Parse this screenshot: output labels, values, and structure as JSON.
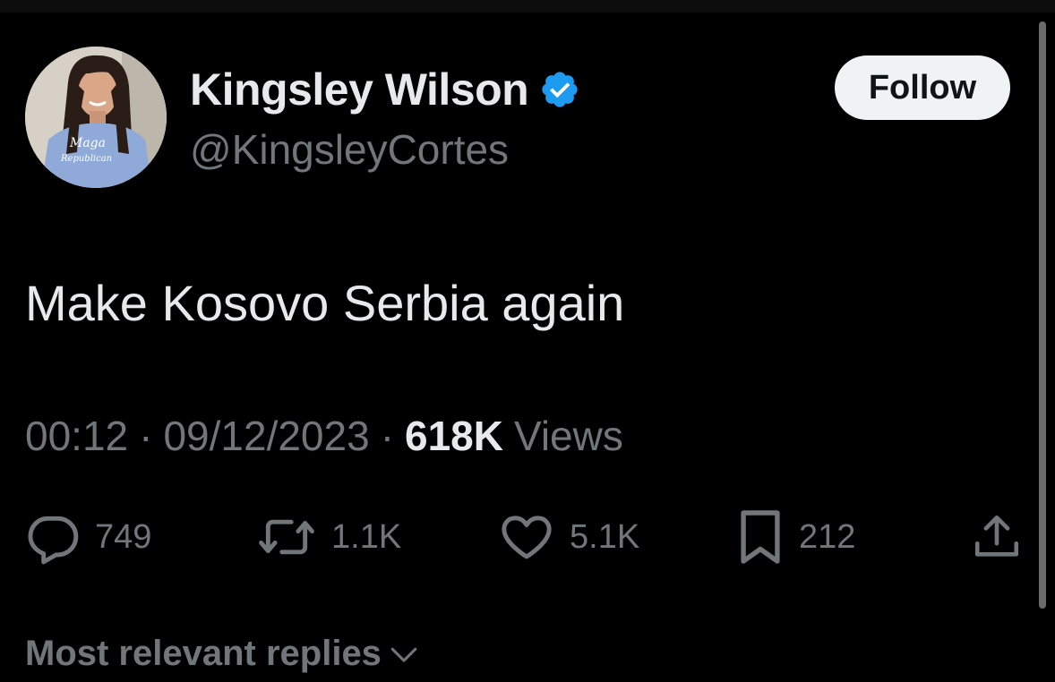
{
  "tweet": {
    "author": {
      "display_name": "Kingsley Wilson",
      "handle": "@KingsleyCortes",
      "verified": true,
      "avatar_shirt_text": [
        "Maga",
        "Republican"
      ]
    },
    "follow_label": "Follow",
    "text": "Make Kosovo Serbia again",
    "time": "00:12",
    "date": "09/12/2023",
    "separator": "·",
    "views_count": "618K",
    "views_label": "Views",
    "actions": {
      "replies": "749",
      "reposts": "1.1K",
      "likes": "5.1K",
      "bookmarks": "212"
    }
  },
  "replies_sort": {
    "label": "Most relevant replies"
  },
  "colors": {
    "background": "#000000",
    "primary_text": "#e7e9ea",
    "secondary_text": "#71767b",
    "verified_badge": "#1d9bf0",
    "follow_button_bg": "#eff3f4",
    "follow_button_text": "#0f1419"
  },
  "icons": {
    "reply": "speech-bubble",
    "repost": "retweet-arrows",
    "like": "heart-outline",
    "bookmark": "bookmark-outline",
    "share": "upload-arrow",
    "verified": "blue-checkmark-badge",
    "replies_sort": "chevron-down"
  }
}
